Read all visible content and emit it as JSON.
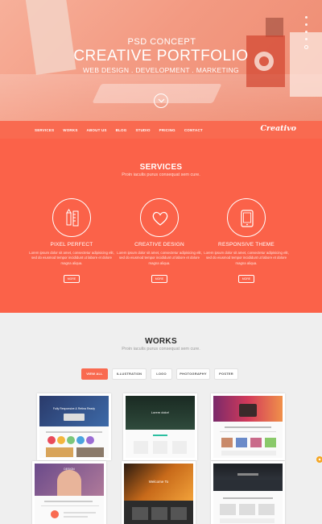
{
  "hero": {
    "subtitle": "PSD CONCEPT",
    "title": "CREATIVE PORTFOLIO",
    "tagline": "WEB DESIGN . DEVELOPMENT . MARKETING",
    "scroll_icon": "chevron-down-icon",
    "slider_dots": 5,
    "active_dot": 5
  },
  "nav": {
    "items": [
      "SERVICES",
      "WORKS",
      "ABOUT US",
      "BLOG",
      "STUDIO",
      "PRICING",
      "CONTACT"
    ],
    "brand": "Creativo"
  },
  "services": {
    "title": "SERVICES",
    "subtitle": "Proin iaculis purus consequat sem cure.",
    "items": [
      {
        "icon": "pencil-ruler-icon",
        "title": "PIXEL PERFECT",
        "text": "Lorem ipsum dolor sit amet, consectetur adipisicing elit, sed do eiusmod tempor incididunt ut labore et dolore magna aliqua.",
        "more": "MORE"
      },
      {
        "icon": "heart-icon",
        "title": "CREATIVE DESIGN",
        "text": "Lorem ipsum dolor sit amet, consectetur adipisicing elit, sed do eiusmod tempor incididunt ut labore et dolore magna aliqua.",
        "more": "MORE"
      },
      {
        "icon": "tablet-icon",
        "title": "RESPONSIVE THEME",
        "text": "Lorem ipsum dolor sit amet, consectetur adipisicing elit, sed do eiusmod tempor incididunt ut labore et dolore magna aliqua.",
        "more": "MORE"
      }
    ]
  },
  "works": {
    "title": "WORKS",
    "subtitle": "Proin iaculis purus consequat sem cure.",
    "filters": [
      "VIEW ALL",
      "ILLUSTRATION",
      "LOGO",
      "PHOTOGRAPHY",
      "POSTER"
    ],
    "active_filter": "VIEW ALL",
    "thumbnails": [
      {
        "caption": "Fully Responsive & Retina Ready"
      },
      {
        "caption": "Lorem dolor!"
      },
      {
        "caption": ""
      },
      {
        "caption": "DESIGN"
      },
      {
        "caption": "Welcome To"
      },
      {
        "caption": ""
      }
    ]
  },
  "colors": {
    "accent": "#f96a50",
    "services_bg": "#fb6249",
    "works_bg": "#efefef"
  }
}
